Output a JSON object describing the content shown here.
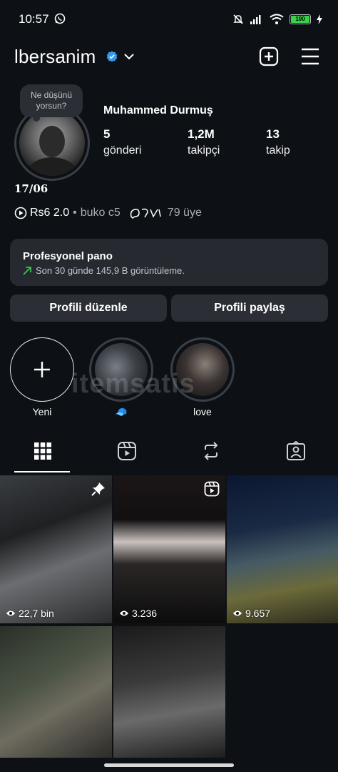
{
  "status_bar": {
    "time": "10:57",
    "battery": "100"
  },
  "header": {
    "username": "lbersanim"
  },
  "note": {
    "text": "Ne düşünü yorsun?"
  },
  "profile": {
    "full_name": "Muhammed Durmuş",
    "stats": [
      {
        "value": "5",
        "label": "gönderi"
      },
      {
        "value": "1,2M",
        "label": "takipçi"
      },
      {
        "value": "13",
        "label": "takip"
      }
    ],
    "bio": "17/06"
  },
  "music": {
    "song": "Rs6 2.0",
    "artist": "buko c5",
    "separator": "•",
    "members": "79 üye"
  },
  "dashboard": {
    "title": "Profesyonel pano",
    "subtitle": "Son 30 günde 145,9 B görüntüleme.",
    "accent": "#3bd04a"
  },
  "buttons": {
    "edit": "Profili düzenle",
    "share": "Profili paylaş"
  },
  "highlights": [
    {
      "label": "Yeni"
    },
    {
      "label": "🧢"
    },
    {
      "label": "love"
    }
  ],
  "watermark": "itemsatis",
  "posts": [
    {
      "views": "22,7 bin",
      "badge": "pin-icon"
    },
    {
      "views": "3.236",
      "badge": "reel-icon"
    },
    {
      "views": "9.657",
      "badge": ""
    },
    {
      "views": "",
      "badge": ""
    },
    {
      "views": "",
      "badge": ""
    }
  ]
}
